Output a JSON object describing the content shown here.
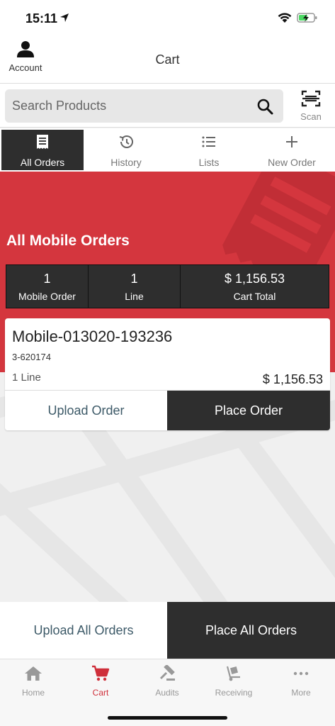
{
  "status": {
    "time": "15:11"
  },
  "nav": {
    "account_label": "Account",
    "title": "Cart"
  },
  "search": {
    "placeholder": "Search Products",
    "scan_label": "Scan"
  },
  "tabs": [
    {
      "label": "All Orders",
      "active": true
    },
    {
      "label": "History"
    },
    {
      "label": "Lists"
    },
    {
      "label": "New Order"
    }
  ],
  "hero": {
    "title": "All Mobile Orders",
    "stats": [
      {
        "value": "1",
        "label": "Mobile Order"
      },
      {
        "value": "1",
        "label": "Line"
      },
      {
        "value": "$ 1,156.53",
        "label": "Cart Total"
      }
    ]
  },
  "order": {
    "name": "Mobile-013020-193236",
    "account": "3-620174",
    "lines": "1 Line",
    "total": "$ 1,156.53",
    "upload_label": "Upload Order",
    "place_label": "Place Order"
  },
  "bulk": {
    "upload_all_label": "Upload All Orders",
    "place_all_label": "Place All Orders"
  },
  "tabbar": [
    {
      "label": "Home"
    },
    {
      "label": "Cart",
      "active": true
    },
    {
      "label": "Audits"
    },
    {
      "label": "Receiving"
    },
    {
      "label": "More"
    }
  ],
  "colors": {
    "accent": "#d4363e",
    "dark": "#2e2e2e",
    "link": "#3d5a68"
  }
}
